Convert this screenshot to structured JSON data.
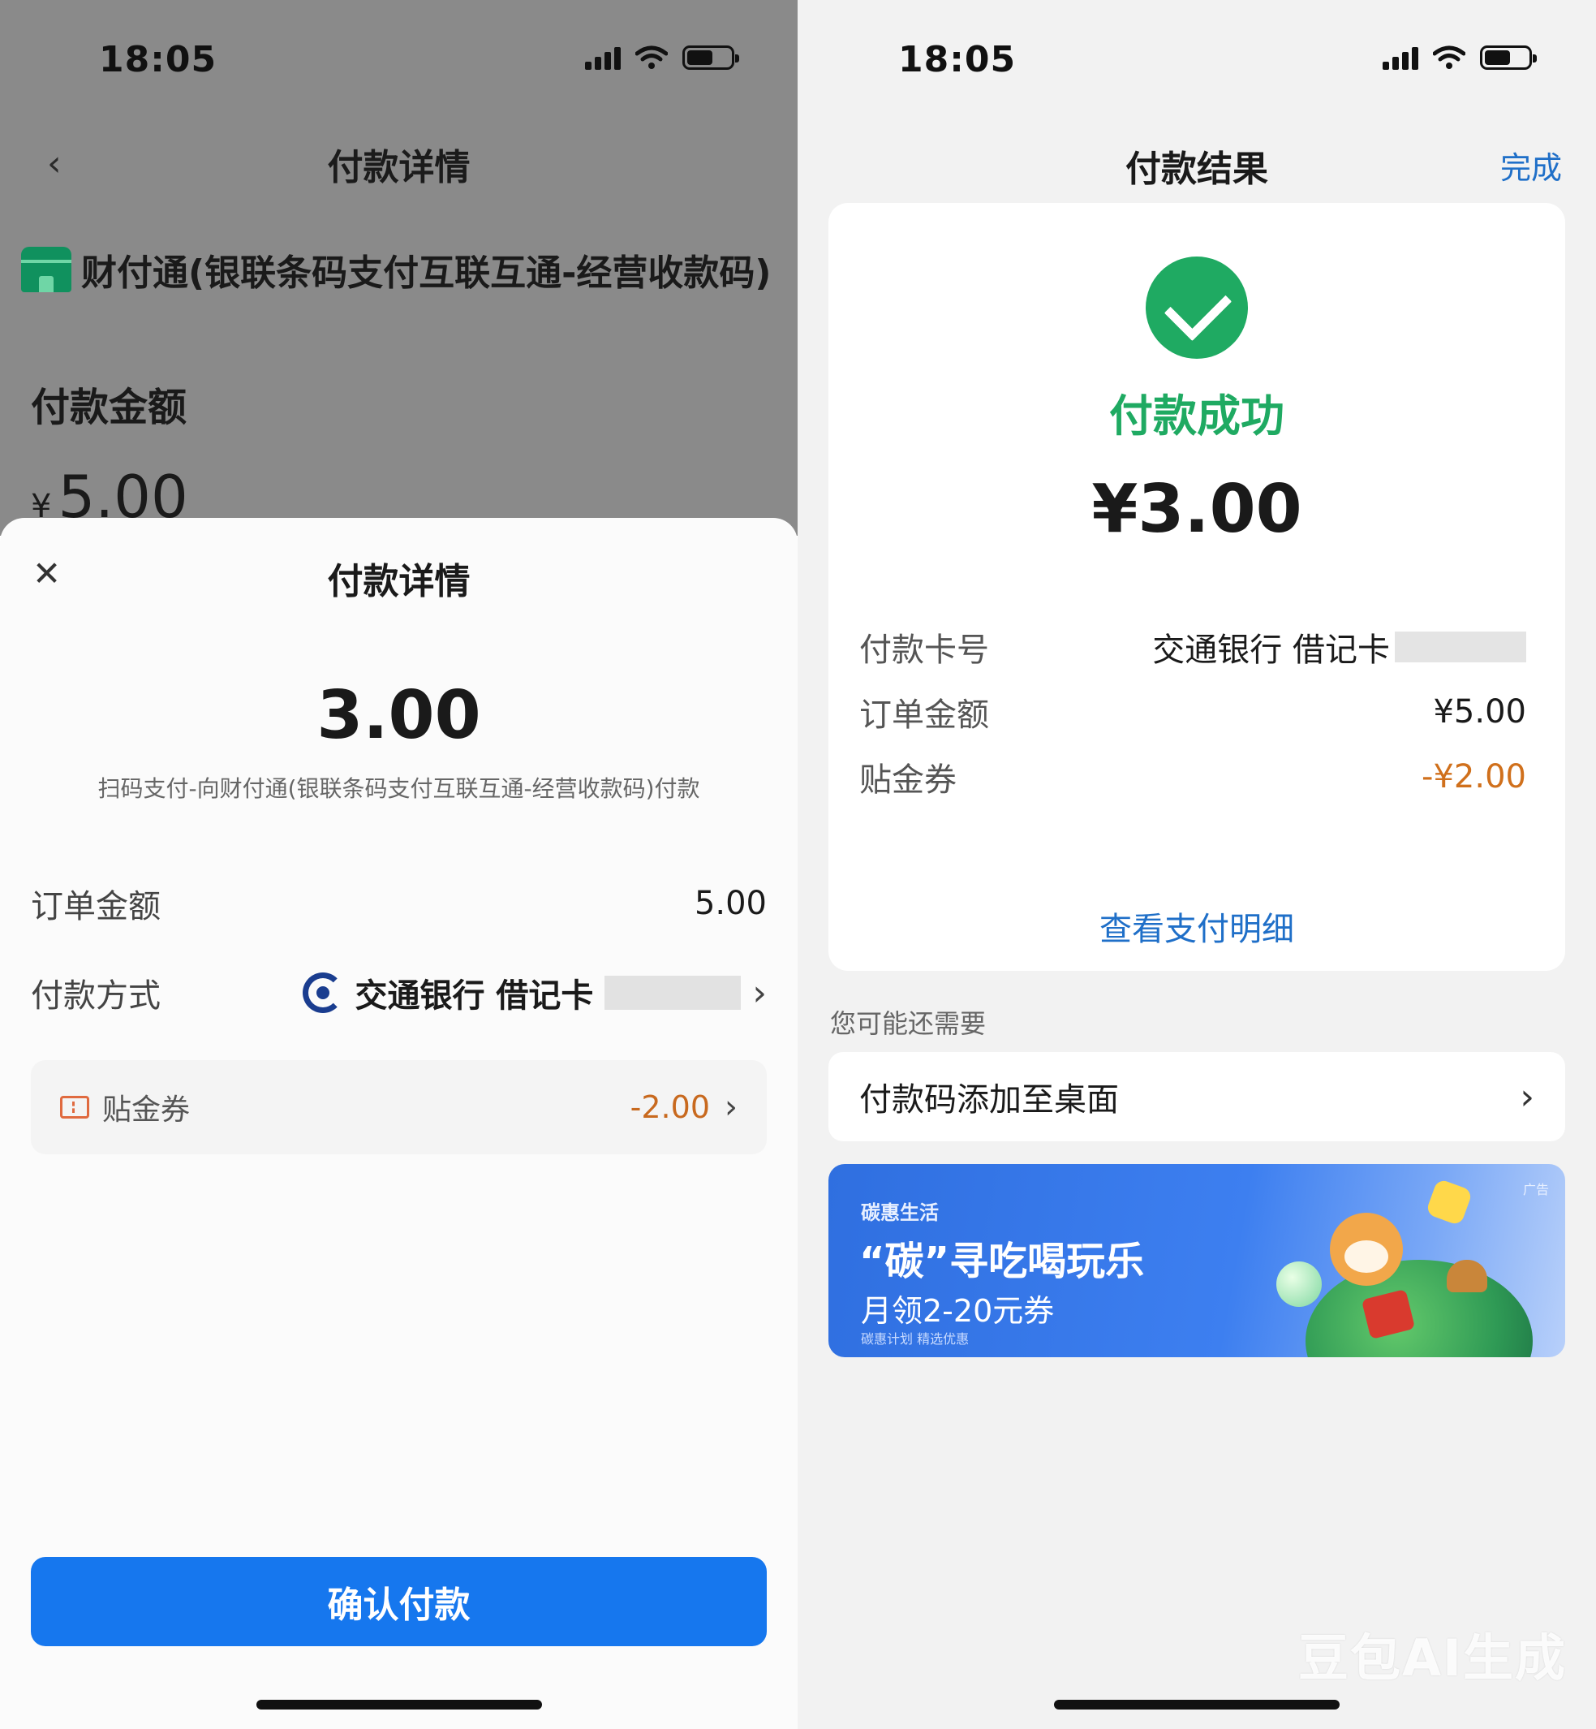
{
  "left": {
    "status": {
      "time": "18:05"
    },
    "nav": {
      "title": "付款详情"
    },
    "merchant": {
      "name": "财付通(银联条码支付互联互通-经营收款码)"
    },
    "background": {
      "amount_label": "付款金额",
      "amount_currency": "¥",
      "amount_value": "5.00"
    },
    "sheet": {
      "title": "付款详情",
      "amount": "3.00",
      "description": "扫码支付-向财付通(银联条码支付互联互通-经营收款码)付款",
      "order_label": "订单金额",
      "order_value": "5.00",
      "method_label": "付款方式",
      "method_bank": "交通银行 借记卡",
      "coupon_label": "贴金券",
      "coupon_value": "-2.00",
      "confirm_label": "确认付款"
    }
  },
  "right": {
    "status": {
      "time": "18:05"
    },
    "nav": {
      "title": "付款结果",
      "done": "完成"
    },
    "result": {
      "status": "付款成功",
      "amount": "¥3.00"
    },
    "details": {
      "card_label": "付款卡号",
      "card_value": "交通银行 借记卡",
      "order_label": "订单金额",
      "order_value": "¥5.00",
      "coupon_label": "贴金券",
      "coupon_value": "-¥2.00",
      "view_detail": "查看支付明细"
    },
    "recommend": {
      "heading": "您可能还需要",
      "shortcut": "付款码添加至桌面"
    },
    "banner": {
      "brand": "碳惠生活",
      "ad_tag": "广告",
      "headline": "“碳”寻吃喝玩乐",
      "subline": "月领2-20元券",
      "footnote": "碳惠计划 精选优惠"
    }
  },
  "watermark": "豆包AI生成",
  "icons": {
    "signal": "signal-icon",
    "wifi": "wifi-icon",
    "battery": "battery-icon",
    "back": "chevron-left-icon",
    "close": "close-icon",
    "shop": "shop-icon",
    "bank": "bank-logo-icon",
    "coupon": "coupon-icon",
    "chevron": "chevron-right-icon",
    "success": "check-circle-icon"
  },
  "colors": {
    "primary_blue": "#1677ee",
    "link_blue": "#1f6fc8",
    "success_green": "#1faa62",
    "coupon_orange": "#d0701c"
  }
}
